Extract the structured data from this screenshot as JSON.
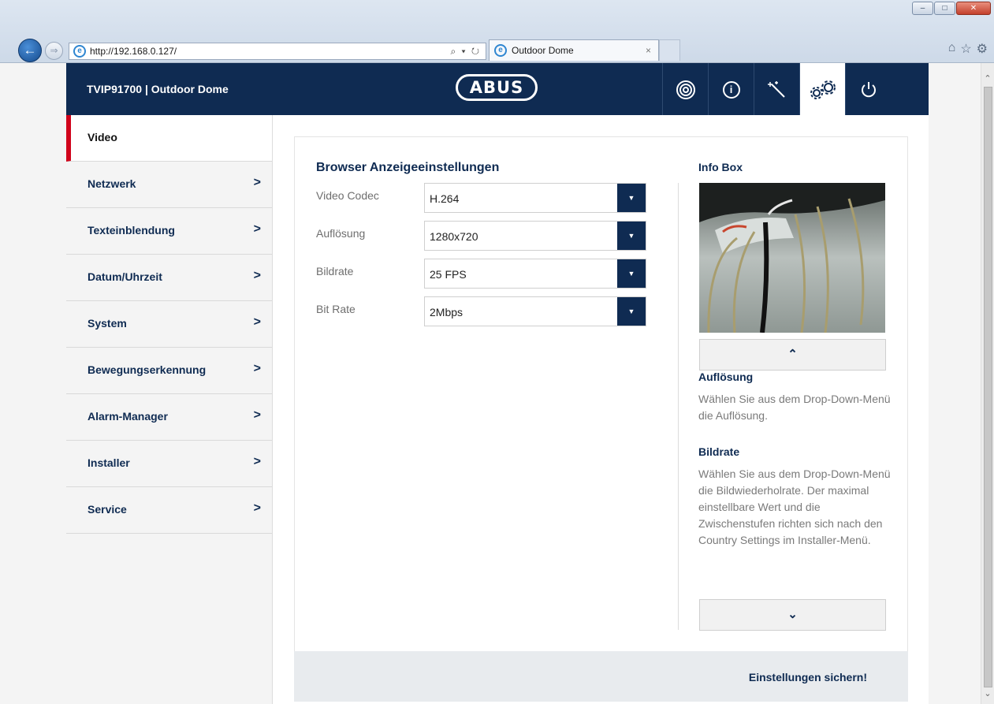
{
  "browser": {
    "url": "http://192.168.0.127/",
    "search_refresh": "⌕ ▾ ↻",
    "tab_title": "Outdoor Dome",
    "tab_close": "×",
    "window_buttons": {
      "minimize": "–",
      "maximize": "□",
      "close": "✕"
    },
    "toolbar_icons": [
      "home-icon",
      "star-icon",
      "gear-icon"
    ]
  },
  "header": {
    "device_title": "TVIP91700 | Outdoor Dome",
    "logo": "ABUS",
    "icons": [
      "live-view-icon",
      "info-icon",
      "wizard-icon",
      "settings-icon",
      "power-icon"
    ],
    "active_icon": "settings-icon"
  },
  "sidebar": {
    "items": [
      {
        "label": "Video",
        "active": true,
        "chevron": ""
      },
      {
        "label": "Netzwerk",
        "chevron": ">"
      },
      {
        "label": "Texteinblendung",
        "chevron": ">"
      },
      {
        "label": "Datum/Uhrzeit",
        "chevron": ">"
      },
      {
        "label": "System",
        "chevron": ">"
      },
      {
        "label": "Bewegungserkennung",
        "chevron": ">"
      },
      {
        "label": "Alarm-Manager",
        "chevron": ">"
      },
      {
        "label": "Installer",
        "chevron": ">"
      },
      {
        "label": "Service",
        "chevron": ">"
      }
    ]
  },
  "main": {
    "title": "Browser Anzeigeeinstellungen",
    "fields": [
      {
        "label": "Video Codec",
        "value": "H.264"
      },
      {
        "label": "Auflösung",
        "value": "1280x720"
      },
      {
        "label": "Bildrate",
        "value": "25 FPS"
      },
      {
        "label": "Bit Rate",
        "value": "2Mbps"
      }
    ],
    "save_label": "Einstellungen sichern!"
  },
  "info_box": {
    "title": "Info Box",
    "sections": [
      {
        "heading": "Auflösung",
        "text": "Wählen Sie aus dem Drop-Down-Menü die Auflösung."
      },
      {
        "heading": "Bildrate",
        "text": "Wählen Sie aus dem Drop-Down-Menü die Bildwiederholrate. Der maximal einstellbare Wert und die Zwischenstufen richten sich nach den Country Settings im Installer-Menü."
      }
    ]
  },
  "colors": {
    "navy": "#0f2b52",
    "accent_red": "#d0021b"
  }
}
